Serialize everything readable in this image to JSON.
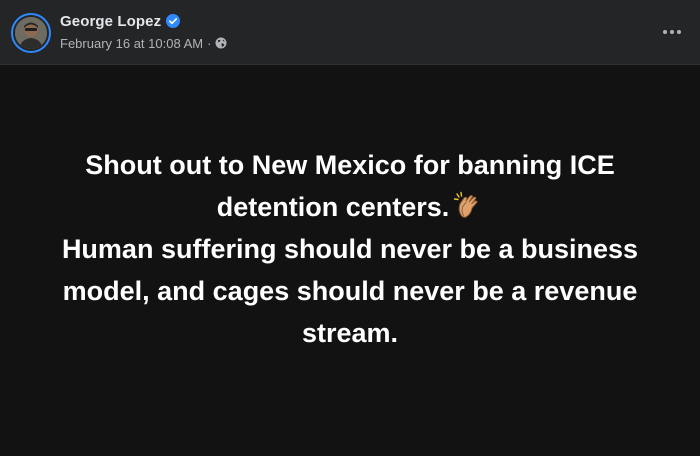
{
  "post": {
    "author_name": "George Lopez",
    "timestamp": "February 16 at 10:08 AM",
    "separator": "·",
    "privacy_icon": "globe-icon",
    "verified_icon": "verified-badge-icon",
    "menu_icon": "more-options-icon",
    "text_line_1": "Shout out to New Mexico for banning ICE",
    "text_line_2": "detention centers.",
    "text_emoji": "clapping-hands-icon",
    "text_line_3": "Human suffering should never be a business",
    "text_line_4": "model, and cages should never be a revenue",
    "text_line_5": "stream."
  },
  "colors": {
    "background": "#121212",
    "header_background": "#242526",
    "accent": "#2e89ff",
    "primary_text": "#e4e6eb",
    "secondary_text": "#b0b3b8"
  }
}
